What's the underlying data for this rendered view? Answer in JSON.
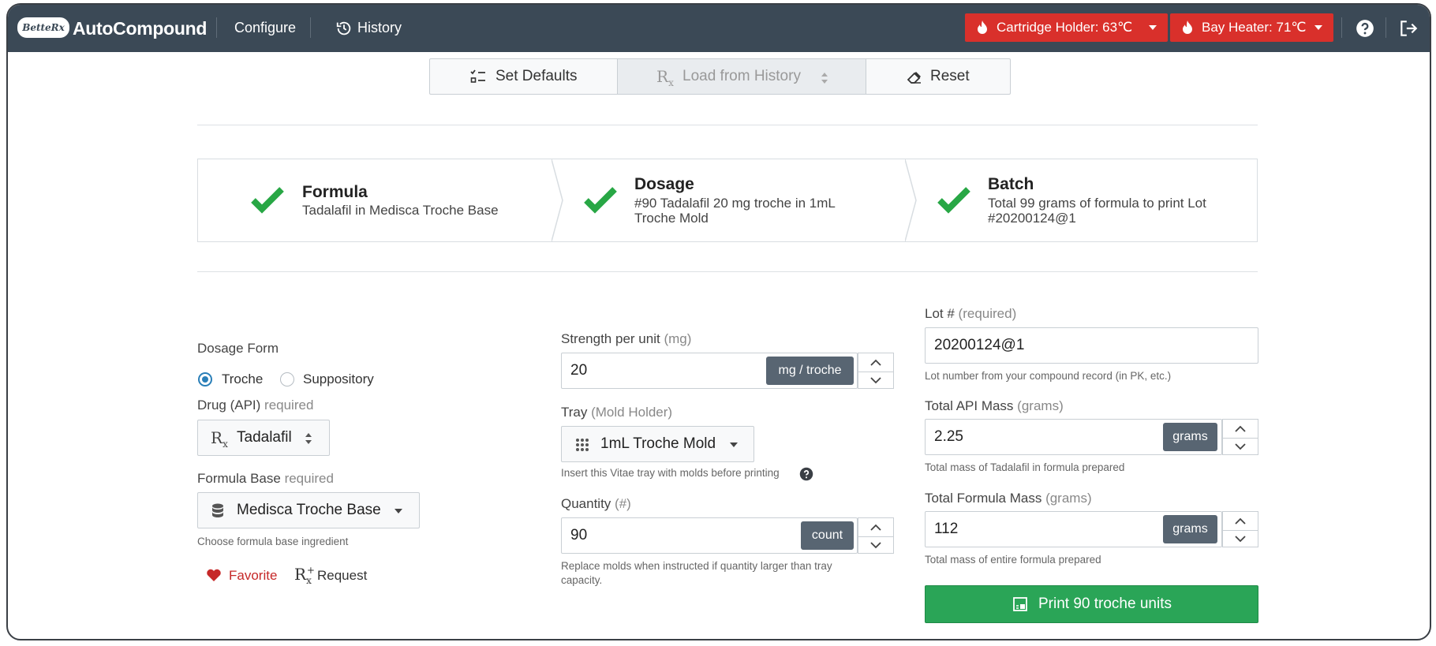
{
  "nav": {
    "logo_text": "BetteRx",
    "app_title": "AutoCompound",
    "configure_label": "Configure",
    "history_label": "History",
    "cartridge_label": "Cartridge Holder: 63℃",
    "bay_label": "Bay Heater: 71℃",
    "alert_color": "#d9302b"
  },
  "toolbar": {
    "set_defaults_label": "Set Defaults",
    "load_history_label": "Load from History",
    "reset_label": "Reset"
  },
  "steps": [
    {
      "title": "Formula",
      "desc": "Tadalafil in Medisca Troche Base"
    },
    {
      "title": "Dosage",
      "desc_line1": "#90 Tadalafil 20 mg troche in 1mL",
      "desc_line2": "Troche Mold"
    },
    {
      "title": "Batch",
      "desc_line1": "Total 99 grams of formula to print Lot",
      "desc_line2": "#20200124@1"
    }
  ],
  "left": {
    "dosage_form_label": "Dosage Form",
    "radio_troche": "Troche",
    "radio_suppository": "Suppository",
    "selected_form": "Troche",
    "drug_label": "Drug (API)",
    "drug_req": "required",
    "drug_value": "Tadalafil",
    "base_label": "Formula Base",
    "base_req": "required",
    "base_value": "Medisca Troche Base",
    "base_help": "Choose formula base ingredient",
    "favorite_label": "Favorite",
    "request_label": "Request"
  },
  "middle": {
    "strength_label": "Strength per unit",
    "strength_unit_hint": "(mg)",
    "strength_value": "20",
    "strength_addon": "mg / troche",
    "tray_label": "Tray",
    "tray_hint": "(Mold Holder)",
    "tray_value": "1mL Troche Mold",
    "tray_help": "Insert this Vitae tray with molds before printing",
    "quantity_label": "Quantity",
    "quantity_hint": "(#)",
    "quantity_value": "90",
    "quantity_addon": "count",
    "quantity_help_1": "Replace molds when instructed if quantity larger than tray",
    "quantity_help_2": "capacity."
  },
  "right": {
    "lot_label": "Lot #",
    "lot_hint": "(required)",
    "lot_value": "20200124@1",
    "lot_help": "Lot number from your compound record (in PK, etc.)",
    "api_label": "Total API Mass",
    "api_hint": "(grams)",
    "api_value": "2.25",
    "api_addon": "grams",
    "api_help": "Total mass of Tadalafil in formula prepared",
    "formula_label": "Total Formula Mass",
    "formula_hint": "(grams)",
    "formula_value": "112",
    "formula_addon": "grams",
    "formula_help": "Total mass of entire formula prepared",
    "print_label": "Print 90 troche units",
    "print_color": "#2aa557"
  }
}
